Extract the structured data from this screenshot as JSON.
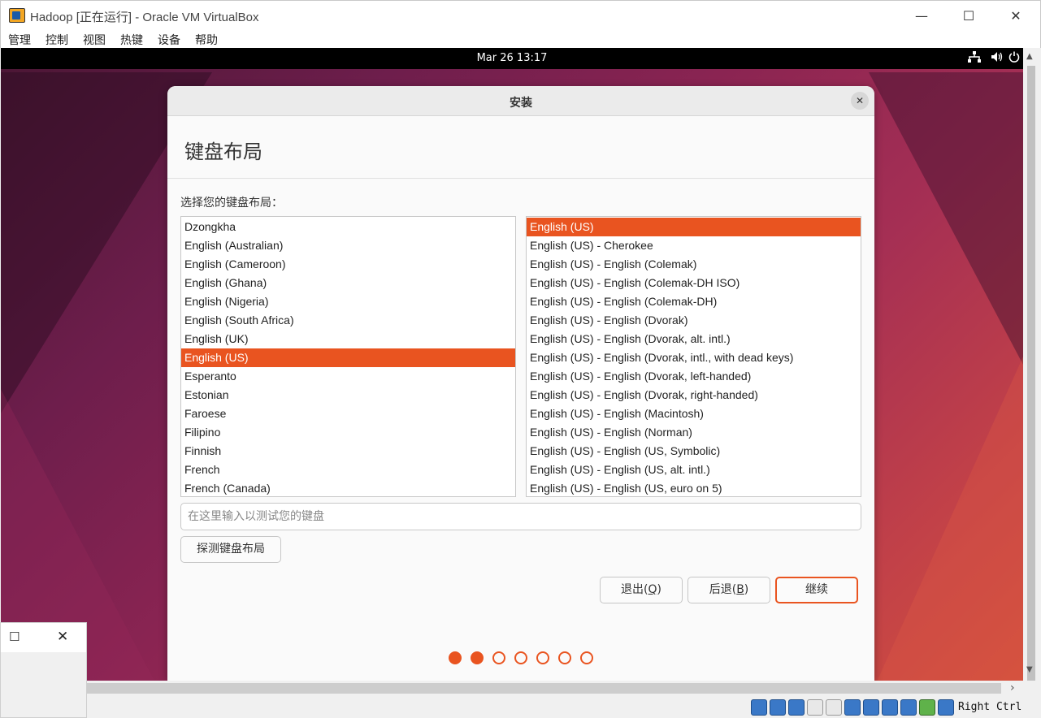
{
  "window": {
    "title": "Hadoop [正在运行] - Oracle VM VirtualBox",
    "minimize": "—",
    "maximize": "☐",
    "close": "✕"
  },
  "menubar": [
    "管理",
    "控制",
    "视图",
    "热键",
    "设备",
    "帮助"
  ],
  "guest_topbar": {
    "clock": "Mar 26  13:17",
    "icons": [
      "network-icon",
      "volume-icon",
      "power-icon"
    ]
  },
  "dialog": {
    "title": "安装",
    "close": "✕",
    "page_title": "键盘布局",
    "prompt": "选择您的键盘布局：",
    "layouts": [
      {
        "label": "Dzongkha",
        "selected": false
      },
      {
        "label": "English (Australian)",
        "selected": false
      },
      {
        "label": "English (Cameroon)",
        "selected": false
      },
      {
        "label": "English (Ghana)",
        "selected": false
      },
      {
        "label": "English (Nigeria)",
        "selected": false
      },
      {
        "label": "English (South Africa)",
        "selected": false
      },
      {
        "label": "English (UK)",
        "selected": false
      },
      {
        "label": "English (US)",
        "selected": true
      },
      {
        "label": "Esperanto",
        "selected": false
      },
      {
        "label": "Estonian",
        "selected": false
      },
      {
        "label": "Faroese",
        "selected": false
      },
      {
        "label": "Filipino",
        "selected": false
      },
      {
        "label": "Finnish",
        "selected": false
      },
      {
        "label": "French",
        "selected": false
      },
      {
        "label": "French (Canada)",
        "selected": false
      }
    ],
    "variants": [
      {
        "label": "English (US)",
        "selected": true
      },
      {
        "label": "English (US) - Cherokee",
        "selected": false
      },
      {
        "label": "English (US) - English (Colemak)",
        "selected": false
      },
      {
        "label": "English (US) - English (Colemak-DH ISO)",
        "selected": false
      },
      {
        "label": "English (US) - English (Colemak-DH)",
        "selected": false
      },
      {
        "label": "English (US) - English (Dvorak)",
        "selected": false
      },
      {
        "label": "English (US) - English (Dvorak, alt. intl.)",
        "selected": false
      },
      {
        "label": "English (US) - English (Dvorak, intl., with dead keys)",
        "selected": false
      },
      {
        "label": "English (US) - English (Dvorak, left-handed)",
        "selected": false
      },
      {
        "label": "English (US) - English (Dvorak, right-handed)",
        "selected": false
      },
      {
        "label": "English (US) - English (Macintosh)",
        "selected": false
      },
      {
        "label": "English (US) - English (Norman)",
        "selected": false
      },
      {
        "label": "English (US) - English (US, Symbolic)",
        "selected": false
      },
      {
        "label": "English (US) - English (US, alt. intl.)",
        "selected": false
      },
      {
        "label": "English (US) - English (US, euro on 5)",
        "selected": false
      }
    ],
    "test_placeholder": "在这里输入以测试您的键盘",
    "test_value": "",
    "detect_button": "探测键盘布局",
    "quit_button": {
      "text": "退出(",
      "key": "Q",
      "end": ")"
    },
    "back_button": {
      "text": "后退(",
      "key": "B",
      "end": ")"
    },
    "continue_button": "继续",
    "steps_total": 7,
    "steps_done": 2,
    "accent_color": "#e95420"
  },
  "statusbar": {
    "host_key": "Right Ctrl",
    "icons": [
      "hard-disk-icon",
      "optical-drive-icon",
      "audio-icon",
      "network-adapter-icon",
      "usb-icon",
      "shared-folder-icon",
      "display-icon",
      "recording-icon",
      "cpu-icon",
      "mouse-integration-icon",
      "keyboard-capture-icon"
    ]
  },
  "mini_window": {
    "maximize": "☐",
    "close": "✕"
  }
}
